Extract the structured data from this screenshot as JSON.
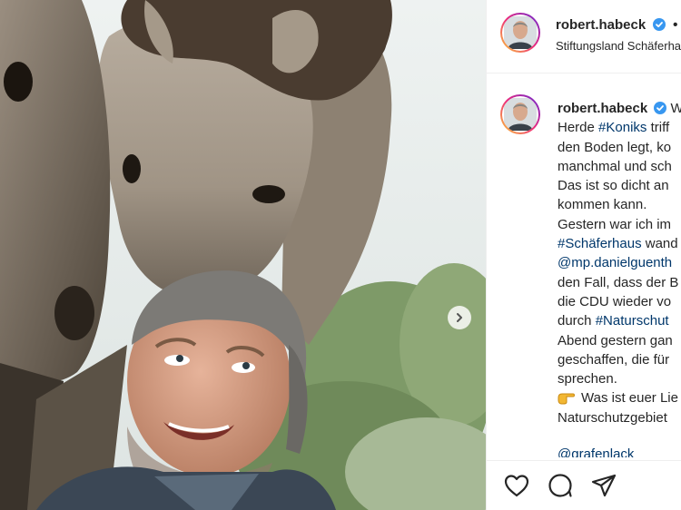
{
  "post": {
    "username": "robert.habeck",
    "dot": "•",
    "location": "Stiftungsland Schäferhaus",
    "verified_icon": "verified-badge-icon",
    "accent_color": "#0095f6"
  },
  "caption": {
    "username": "robert.habeck",
    "lines": [
      [
        {
          "t": "W",
          "tag": false
        }
      ],
      [
        {
          "t": "Herde ",
          "tag": false
        },
        {
          "t": "#Koniks",
          "tag": true
        },
        {
          "t": " triff",
          "tag": false
        }
      ],
      [
        {
          "t": "den Boden legt, ko",
          "tag": false
        }
      ],
      [
        {
          "t": "manchmal und sch",
          "tag": false
        }
      ],
      [
        {
          "t": "Das ist so dicht an",
          "tag": false
        }
      ],
      [
        {
          "t": "kommen kann.",
          "tag": false
        }
      ],
      [
        {
          "t": "Gestern war ich im",
          "tag": false
        }
      ],
      [
        {
          "t": "#Schäferhaus",
          "tag": true
        },
        {
          "t": " wand",
          "tag": false
        }
      ],
      [
        {
          "t": "@mp.danielguenth",
          "tag": true
        }
      ],
      [
        {
          "t": "den Fall, dass der B",
          "tag": false
        }
      ],
      [
        {
          "t": "die CDU wieder vo",
          "tag": false
        }
      ],
      [
        {
          "t": "durch ",
          "tag": false
        },
        {
          "t": "#Naturschut",
          "tag": true
        }
      ],
      [
        {
          "t": "Abend gestern gan",
          "tag": false
        }
      ],
      [
        {
          "t": "geschaffen, die für",
          "tag": false
        }
      ],
      [
        {
          "t": "sprechen.",
          "tag": false
        }
      ],
      [
        {
          "t": "Was ist euer Lie",
          "tag": false
        }
      ],
      [
        {
          "t": "Naturschutzgebiet",
          "tag": false
        }
      ]
    ],
    "next_comment": "@grafenlack"
  },
  "icons": {
    "like": "heart-icon",
    "comment": "comment-icon",
    "share": "share-icon",
    "next": "chevron-right-icon",
    "pointing": "pointing-hand-icon"
  }
}
